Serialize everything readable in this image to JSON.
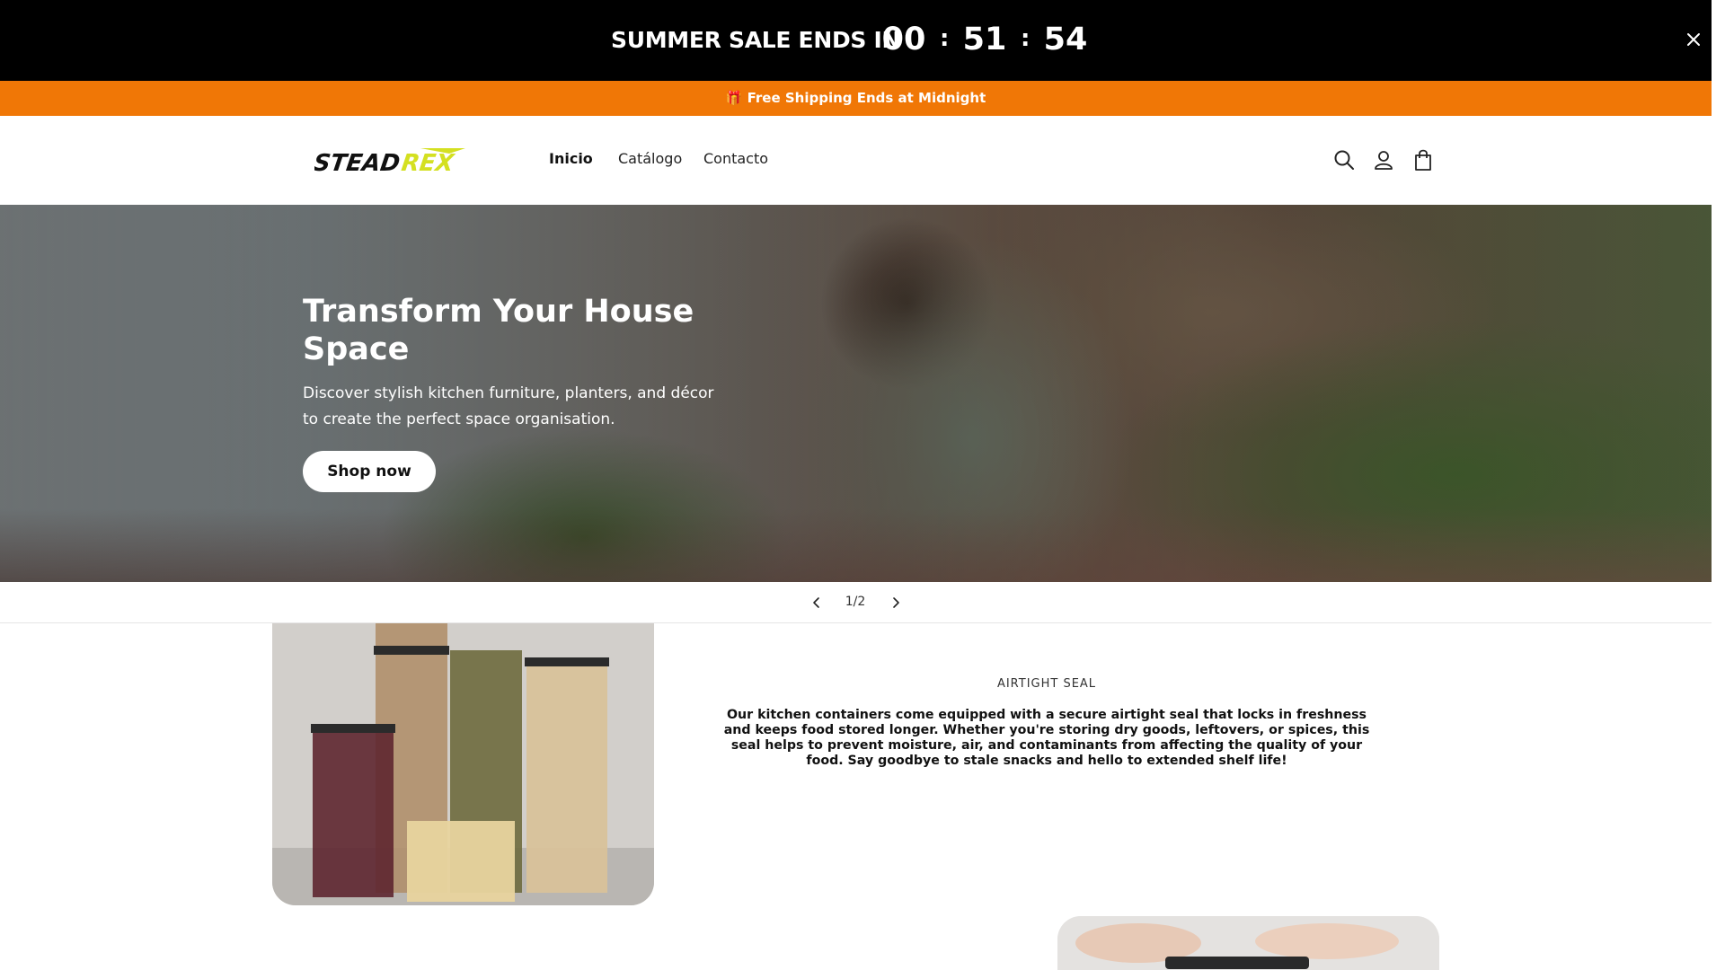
{
  "countdown": {
    "title": "SUMMER SALE ENDS IN",
    "hours": "00",
    "minutes": "51",
    "seconds": "54",
    "separator": ":"
  },
  "shipping_bar": {
    "text": "🎁 Free Shipping Ends at Midnight",
    "color": "#f07706"
  },
  "header": {
    "logo_text": "STEADREX",
    "nav": [
      {
        "label": "Inicio",
        "active": true
      },
      {
        "label": "Catálogo"
      },
      {
        "label": "Contacto"
      }
    ],
    "icons": [
      "search-icon",
      "account-icon",
      "cart-icon"
    ]
  },
  "hero": {
    "title": "Transform Your House Space",
    "subtitle": "Discover stylish kitchen furniture, planters, and décor to create the perfect space organisation.",
    "cta": "Shop now"
  },
  "slider": {
    "counter": "1/2"
  },
  "feature": {
    "label": "AIRTIGHT SEAL",
    "text": "Our kitchen containers come equipped with a secure airtight seal that locks in freshness and keeps food stored longer. Whether you're storing dry goods, leftovers, or spices, this seal helps to prevent moisture, air, and contaminants from affecting the quality of your food. Say goodbye to stale snacks and hello to extended shelf life!"
  },
  "colors": {
    "accent": "#f07706",
    "logo_highlight": "#d4e021"
  }
}
